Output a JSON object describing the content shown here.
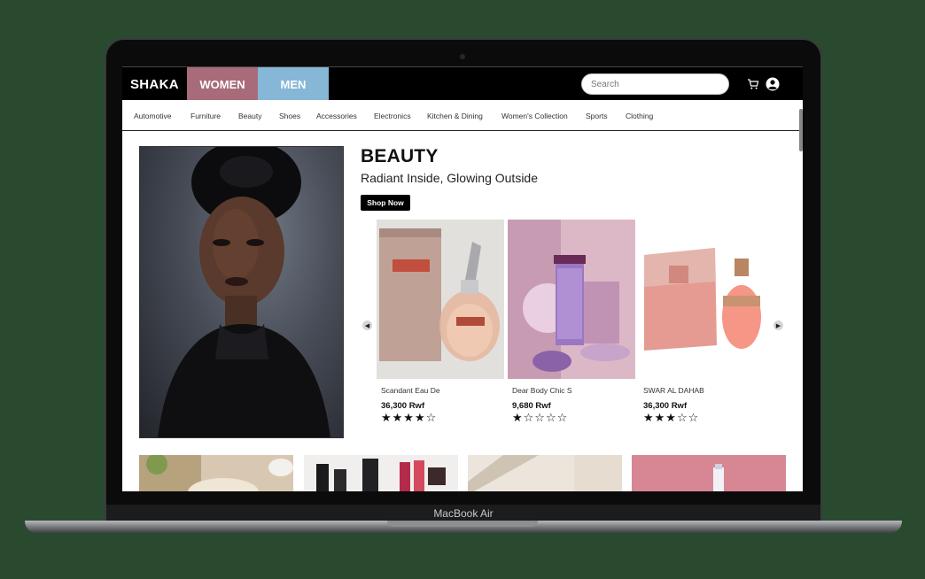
{
  "device": {
    "label": "MacBook Air"
  },
  "header": {
    "logo": "SHAKA",
    "tabs": [
      {
        "label": "WOMEN",
        "color": "#a86b79"
      },
      {
        "label": "MEN",
        "color": "#86b7d6"
      }
    ],
    "search_placeholder": "Search",
    "icons": [
      "cart-icon",
      "user-icon"
    ]
  },
  "categories": [
    "Automotive",
    "Furniture",
    "Beauty",
    "Shoes",
    "Accessories",
    "Electronics",
    "Kitchen & Dining",
    "Women's Collection",
    "Sports",
    "Clothing"
  ],
  "hero": {
    "title": "BEAUTY",
    "subtitle": "Radiant Inside, Glowing Outside",
    "cta": "Shop Now"
  },
  "carousel": {
    "prev_icon": "chevron-left-icon",
    "next_icon": "chevron-right-icon",
    "products": [
      {
        "name": "Scandant Eau De",
        "price": "36,300 Rwf",
        "rating": 4,
        "stars": "★★★★☆"
      },
      {
        "name": "Dear Body Chic S",
        "price": "9,680 Rwf",
        "rating": 1,
        "stars": "★☆☆☆☆"
      },
      {
        "name": "SWAR AL DAHAB",
        "price": "36,300 Rwf",
        "rating": 3,
        "stars": "★★★☆☆"
      }
    ]
  },
  "colors": {
    "background": "#2a4a30",
    "topbar": "#000000",
    "women": "#a86b79",
    "men": "#86b7d6"
  }
}
